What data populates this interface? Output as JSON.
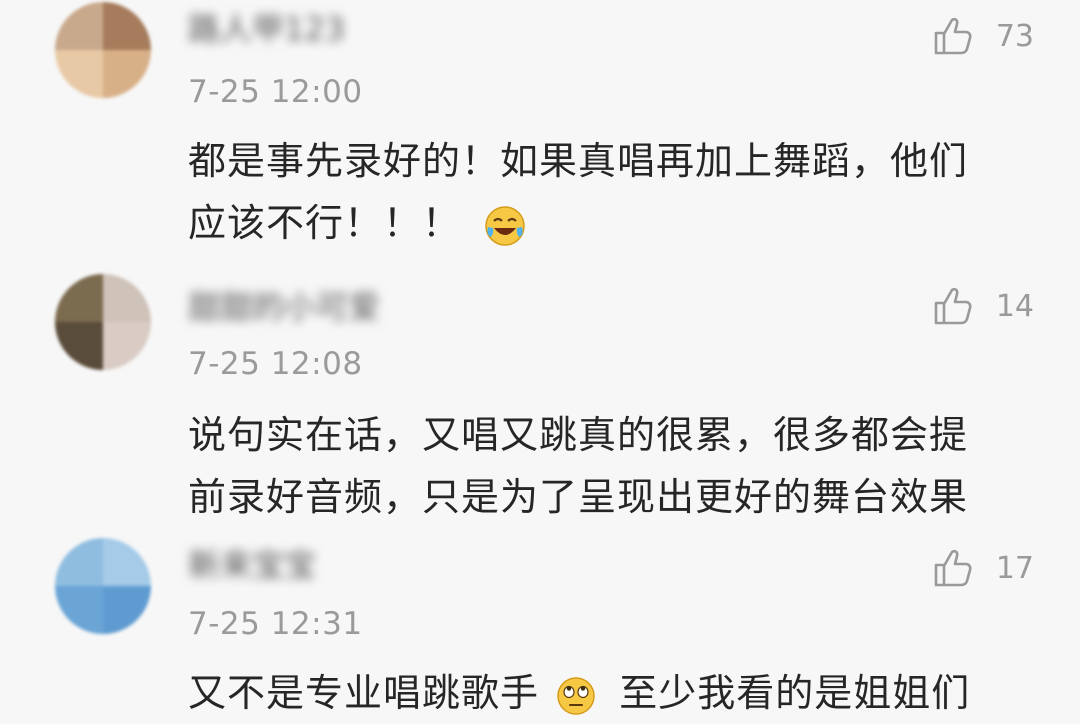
{
  "comments": [
    {
      "username": "路人甲123",
      "time": "7-25 12:00",
      "text_lines": [
        "都是事先录好的！如果真唱再加上舞蹈，他们",
        "应该不行！！！"
      ],
      "likes": "73",
      "emoji": "laughing-tears-icon",
      "avatar_colors": [
        "#c9a98c",
        "#a67c5c",
        "#e8c9a6",
        "#d8b088"
      ]
    },
    {
      "username": "甜甜的小可爱",
      "time": "7-25 12:08",
      "text_lines": [
        "说句实在话，又唱又跳真的很累，很多都会提",
        "前录好音频，只是为了呈现出更好的舞台效果"
      ],
      "likes": "14",
      "avatar_colors": [
        "#7b6b4f",
        "#cfc2b8",
        "#5a4c3a",
        "#d9ccc4"
      ]
    },
    {
      "username": "新来宝宝",
      "time": "7-25 12:31",
      "text_lines": [
        "又不是专业唱跳歌手",
        "至少我看的是姐姐们"
      ],
      "likes": "17",
      "emoji": "eye-roll-icon",
      "avatar_colors": [
        "#8fbde0",
        "#a5cbe8",
        "#6aa5d6",
        "#5f9bd1"
      ]
    }
  ],
  "colors": {
    "background": "#f7f7f7",
    "text": "#262626",
    "meta": "#9a9a9a"
  }
}
